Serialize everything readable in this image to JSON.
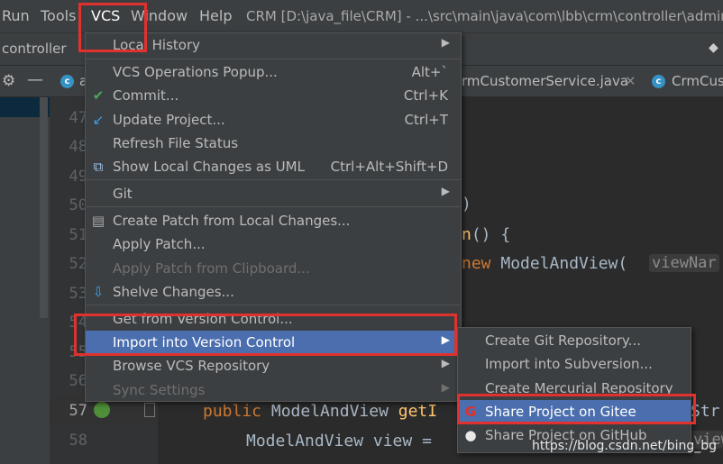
{
  "menubar": {
    "items": [
      "Run",
      "Tools",
      "VCS",
      "Window",
      "Help"
    ],
    "title": "CRM [D:\\java_file\\CRM] - ...\\src\\main\\java\\com\\lbb\\crm\\controller\\admin"
  },
  "breadcrumb": {
    "text": "controller"
  },
  "tabs": [
    {
      "label": "a",
      "icon": "class-icon"
    },
    {
      "label": "rmCustomerService.java",
      "icon": ""
    },
    {
      "label": "CrmCus",
      "icon": "class-icon"
    }
  ],
  "gutter": {
    "lines": [
      "47",
      "48",
      "49",
      "50",
      "51",
      "52",
      "53",
      "54",
      "55",
      "56",
      "57",
      "58"
    ],
    "current": "57"
  },
  "code": {
    "l50": ")",
    "l51_fn": "n",
    "l51_rest": "() {",
    "l52_kw": "new",
    "l52_rest": " ModelAndView(",
    "l52_hint": "viewNar",
    "l57_kw": "public",
    "l57_rest": " ModelAndView ",
    "l57_fn": "getI",
    "l57_tail": "Str",
    "l58": "ModelAndView view = ",
    "l58_hint": "viewNar"
  },
  "vcs_menu": {
    "items": [
      {
        "label": "Local History",
        "shortcut": "",
        "submenu": true,
        "icon": "",
        "disabled": false
      },
      {
        "label": "VCS Operations Popup...",
        "shortcut": "Alt+`",
        "submenu": false,
        "icon": "",
        "disabled": false
      },
      {
        "label": "Commit...",
        "shortcut": "Ctrl+K",
        "submenu": false,
        "icon": "check-icon",
        "disabled": false
      },
      {
        "label": "Update Project...",
        "shortcut": "Ctrl+T",
        "submenu": false,
        "icon": "update-arrow-icon",
        "disabled": false
      },
      {
        "label": "Refresh File Status",
        "shortcut": "",
        "submenu": false,
        "icon": "",
        "disabled": false
      },
      {
        "label": "Show Local Changes as UML",
        "shortcut": "Ctrl+Alt+Shift+D",
        "submenu": false,
        "icon": "uml-icon",
        "disabled": false
      },
      {
        "label": "Git",
        "shortcut": "",
        "submenu": true,
        "icon": "",
        "disabled": false
      },
      {
        "label": "Create Patch from Local Changes...",
        "shortcut": "",
        "submenu": false,
        "icon": "patch-icon",
        "disabled": false
      },
      {
        "label": "Apply Patch...",
        "shortcut": "",
        "submenu": false,
        "icon": "",
        "disabled": false
      },
      {
        "label": "Apply Patch from Clipboard...",
        "shortcut": "",
        "submenu": false,
        "icon": "",
        "disabled": true
      },
      {
        "label": "Shelve Changes...",
        "shortcut": "",
        "submenu": false,
        "icon": "shelve-icon",
        "disabled": false
      },
      {
        "label": "Get from Version Control...",
        "shortcut": "",
        "submenu": false,
        "icon": "",
        "disabled": false
      },
      {
        "label": "Import into Version Control",
        "shortcut": "",
        "submenu": true,
        "icon": "",
        "disabled": false,
        "selected": true
      },
      {
        "label": "Browse VCS Repository",
        "shortcut": "",
        "submenu": true,
        "icon": "",
        "disabled": false
      },
      {
        "label": "Sync Settings",
        "shortcut": "",
        "submenu": true,
        "icon": "",
        "disabled": true
      }
    ]
  },
  "import_submenu": {
    "items": [
      {
        "label": "Create Git Repository...",
        "icon": ""
      },
      {
        "label": "Import into Subversion...",
        "icon": ""
      },
      {
        "label": "Create Mercurial Repository",
        "icon": ""
      },
      {
        "label": "Share Project on Gitee",
        "icon": "gitee-icon",
        "selected": true
      },
      {
        "label": "Share Project on GitHub",
        "icon": "github-icon"
      }
    ]
  },
  "watermark": "https://blog.csdn.net/bing_bg",
  "colors": {
    "highlight": "#e0312e",
    "selection": "#4b6eaf",
    "menu_bg": "#3c3f41"
  }
}
